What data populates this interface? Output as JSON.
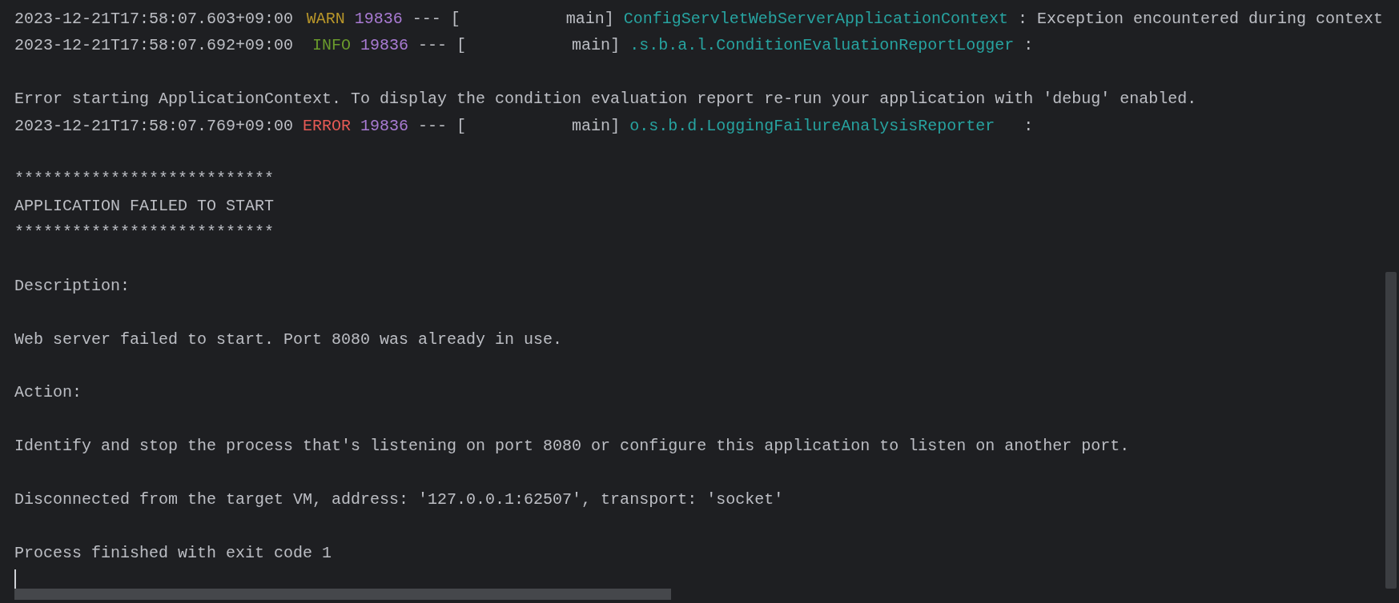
{
  "console": {
    "lines": [
      {
        "kind": "log",
        "timestamp": "2023-12-21T17:58:07.603+09:00",
        "level": {
          "text": "WARN",
          "color": "#b8962a"
        },
        "pid": "19836",
        "dashes": "---",
        "thread": "[           main]",
        "logger": "ConfigServletWebServerApplicationContext",
        "message": ": Exception encountered during context"
      },
      {
        "kind": "log",
        "timestamp": "2023-12-21T17:58:07.692+09:00",
        "level": {
          "text": "INFO",
          "color": "#6a9a2c"
        },
        "pid": "19836",
        "dashes": "---",
        "thread": "[           main]",
        "logger": ".s.b.a.l.ConditionEvaluationReportLogger",
        "message": ":"
      },
      {
        "kind": "blank"
      },
      {
        "kind": "text",
        "text": "Error starting ApplicationContext. To display the condition evaluation report re-run your application with 'debug' enabled."
      },
      {
        "kind": "log",
        "timestamp": "2023-12-21T17:58:07.769+09:00",
        "level": {
          "text": "ERROR",
          "color": "#e55a55"
        },
        "pid": "19836",
        "dashes": "---",
        "thread": "[           main]",
        "logger": "o.s.b.d.LoggingFailureAnalysisReporter",
        "message": ":"
      },
      {
        "kind": "blank"
      },
      {
        "kind": "text",
        "text": "***************************"
      },
      {
        "kind": "text",
        "text": "APPLICATION FAILED TO START"
      },
      {
        "kind": "text",
        "text": "***************************"
      },
      {
        "kind": "blank"
      },
      {
        "kind": "text",
        "text": "Description:"
      },
      {
        "kind": "blank"
      },
      {
        "kind": "text",
        "text": "Web server failed to start. Port 8080 was already in use."
      },
      {
        "kind": "blank"
      },
      {
        "kind": "text",
        "text": "Action:"
      },
      {
        "kind": "blank"
      },
      {
        "kind": "text",
        "text": "Identify and stop the process that's listening on port 8080 or configure this application to listen on another port."
      },
      {
        "kind": "blank"
      },
      {
        "kind": "text",
        "text": "Disconnected from the target VM, address: '127.0.0.1:62507', transport: 'socket'"
      },
      {
        "kind": "blank"
      },
      {
        "kind": "text",
        "text": "Process finished with exit code 1"
      }
    ]
  }
}
